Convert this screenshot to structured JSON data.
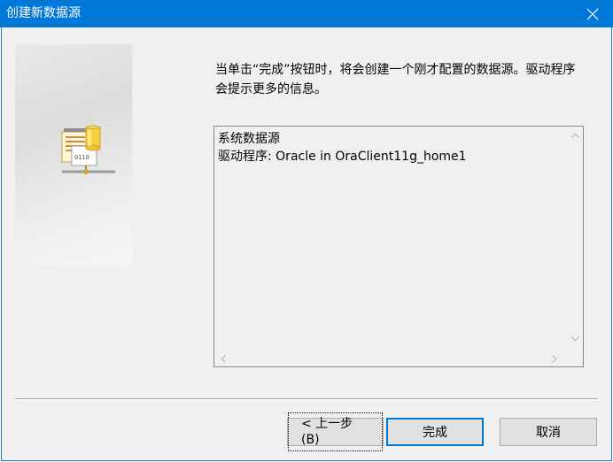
{
  "window": {
    "title": "创建新数据源",
    "titlebar_color": "#0078d7"
  },
  "icons": {
    "close": "close-icon",
    "side": "database-server-icon"
  },
  "instruction": "当单击“完成”按钮时，将会创建一个刚才配置的数据源。驱动程序会提示更多的信息。",
  "info": {
    "lines": [
      "系统数据源",
      "驱动程序:  Oracle in OraClient11g_home1"
    ]
  },
  "buttons": {
    "back": "< 上一步(B)",
    "finish": "完成",
    "cancel": "取消"
  }
}
